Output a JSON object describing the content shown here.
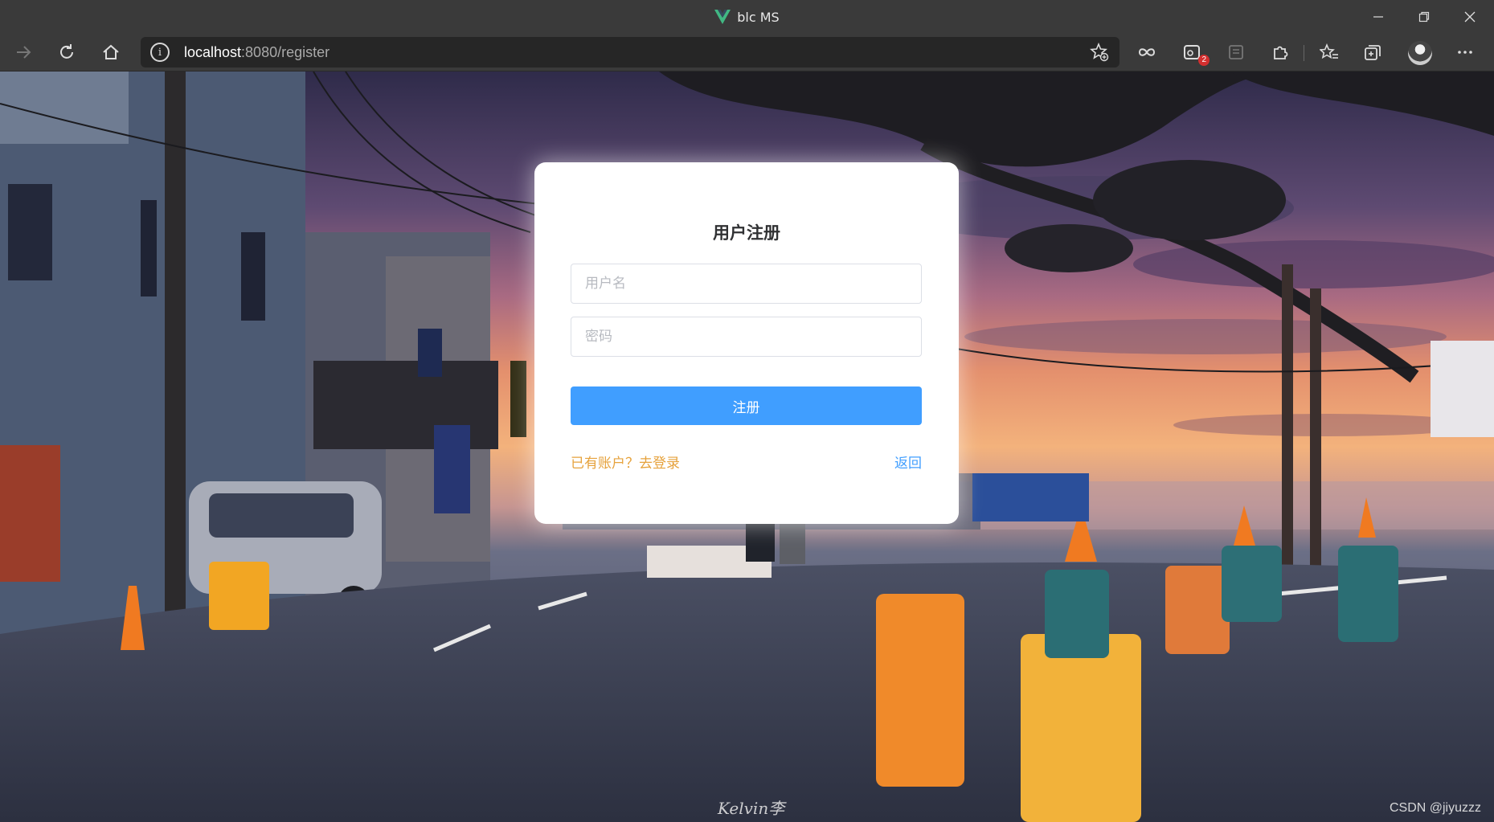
{
  "window": {
    "title": "blc MS"
  },
  "toolbar": {
    "icons": {
      "forward": "arrow-right-icon",
      "reload": "reload-icon",
      "home": "home-icon",
      "favorites_add": "add-favorite-icon",
      "extensions": "puzzle-icon"
    },
    "url_host": "localhost",
    "url_rest": ":8080/register",
    "extension_badge": "2"
  },
  "register": {
    "title": "用户注册",
    "username_placeholder": "用户名",
    "password_placeholder": "密码",
    "submit_label": "注册",
    "login_link": "已有账户？去登录",
    "back_link": "返回"
  },
  "watermark": {
    "text": "CSDN @jiyuzzz",
    "photographer": "Kelvin李"
  },
  "colors": {
    "primary": "#409eff",
    "warning": "#e6a23c",
    "title": "#303133"
  }
}
